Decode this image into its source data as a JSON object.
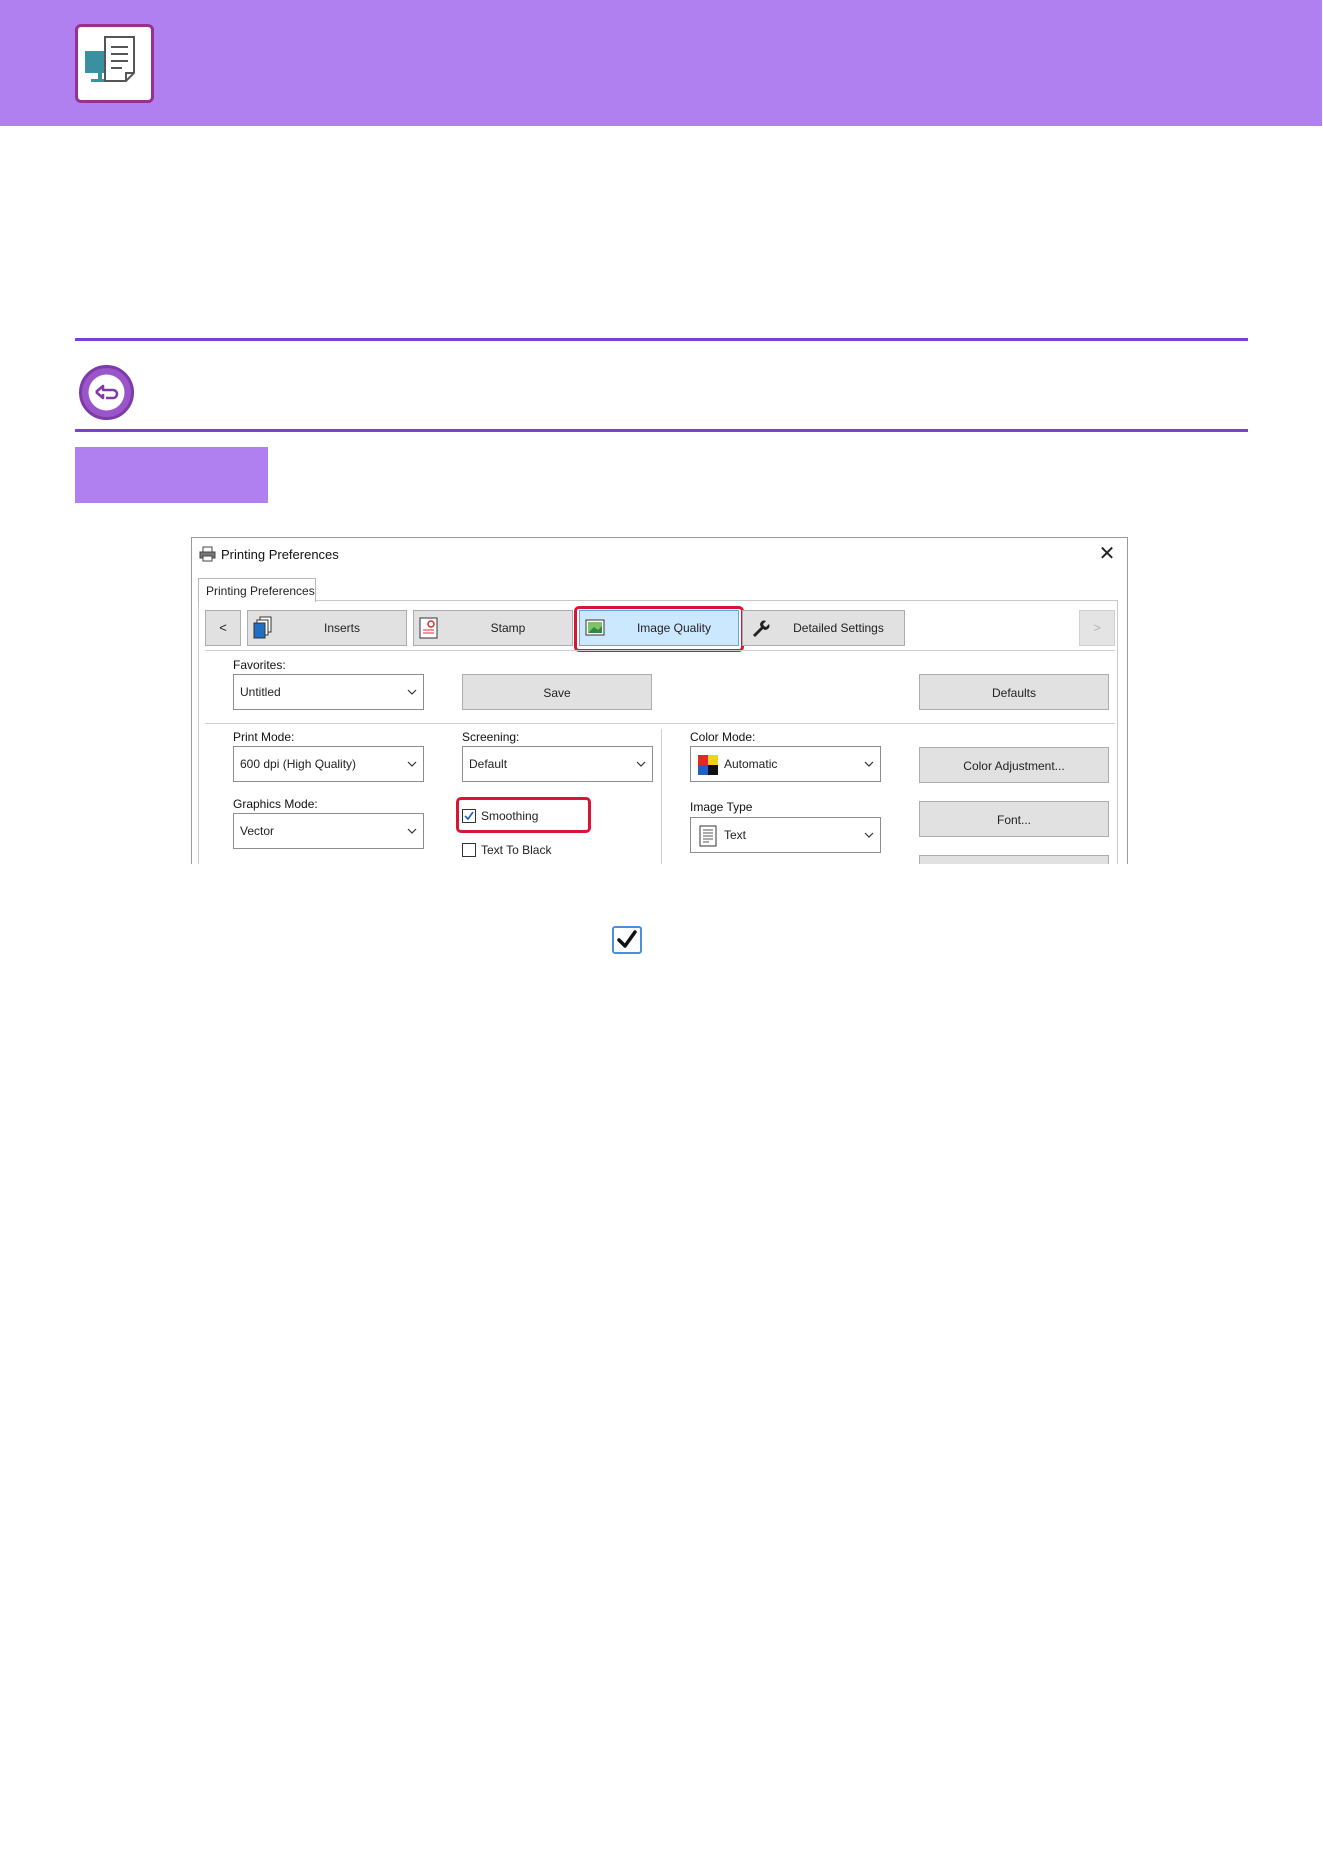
{
  "dialog": {
    "title": "Printing Preferences",
    "outer_tab": "Printing Preferences",
    "ribbon": {
      "prev_label": "<",
      "next_label": ">",
      "tabs": [
        {
          "label": "Inserts"
        },
        {
          "label": "Stamp"
        },
        {
          "label": "Image Quality",
          "selected": true
        },
        {
          "label": "Detailed Settings"
        }
      ]
    },
    "favorites": {
      "label": "Favorites:",
      "value": "Untitled"
    },
    "buttons": {
      "save": "Save",
      "defaults": "Defaults",
      "color_adjustment": "Color Adjustment...",
      "font": "Font..."
    },
    "print_mode": {
      "label": "Print Mode:",
      "value": "600 dpi (High Quality)"
    },
    "graphics_mode": {
      "label": "Graphics Mode:",
      "value": "Vector"
    },
    "screening": {
      "label": "Screening:",
      "value": "Default"
    },
    "smoothing": {
      "label": "Smoothing",
      "checked": true
    },
    "text_to_black": {
      "label": "Text To Black",
      "checked": false
    },
    "color_mode": {
      "label": "Color Mode:",
      "value": "Automatic"
    },
    "image_type": {
      "label": "Image Type",
      "value": "Text"
    }
  },
  "colors": {
    "header_band": "#b07ff0",
    "accent_line": "#7a3fd4",
    "highlight_box": "#d81535",
    "selected_tab": "#cce8ff"
  },
  "icons": [
    "document-monitor-icon",
    "back-arrow-icon",
    "printer-icon",
    "close-icon",
    "inserts-icon",
    "stamp-icon",
    "image-quality-icon",
    "wrench-icon",
    "chevron-down-icon",
    "color-mode-icon",
    "image-type-icon",
    "checkbox-checked-icon"
  ]
}
